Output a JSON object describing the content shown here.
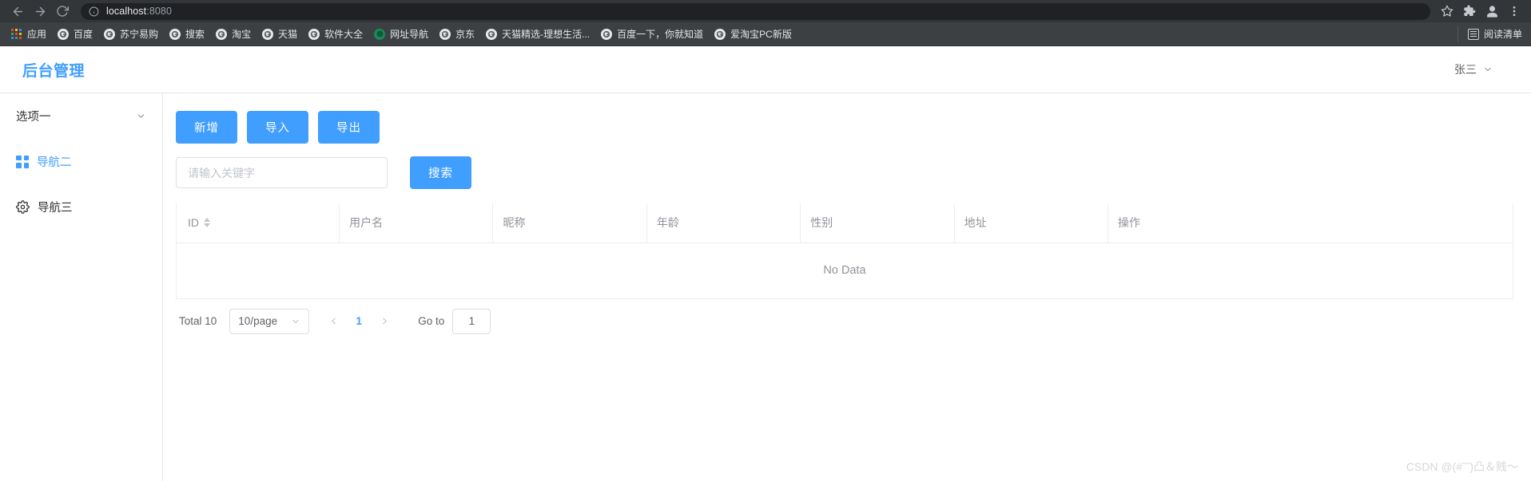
{
  "browser": {
    "back_label": "back-arrow",
    "forward_label": "forward-arrow",
    "reload_label": "reload",
    "url_host": "localhost",
    "url_port": ":8080",
    "star_label": "bookmark-star",
    "extensions_label": "extensions",
    "profile_label": "profile",
    "menu_label": "chrome-menu"
  },
  "bookmarks": {
    "apps_label": "应用",
    "items": [
      {
        "label": "百度",
        "color": "#e8e8e8"
      },
      {
        "label": "苏宁易购",
        "color": "#e8e8e8"
      },
      {
        "label": "搜索",
        "color": "#e8e8e8"
      },
      {
        "label": "淘宝",
        "color": "#e8e8e8"
      },
      {
        "label": "天猫",
        "color": "#e8e8e8"
      },
      {
        "label": "软件大全",
        "color": "#e8e8e8"
      },
      {
        "label": "网址导航",
        "color": "#1b8a5a"
      },
      {
        "label": "京东",
        "color": "#e8e8e8"
      },
      {
        "label": "天猫精选-理想生活...",
        "color": "#e8e8e8"
      },
      {
        "label": "百度一下，你就知道",
        "color": "#e8e8e8"
      },
      {
        "label": "爱淘宝PC新版",
        "color": "#e8e8e8"
      }
    ],
    "reading_list": "阅读清单"
  },
  "header": {
    "title": "后台管理",
    "user_name": "张三"
  },
  "sidebar": {
    "items": [
      {
        "label": "选项一",
        "icon": "chevron-down-icon",
        "active": false
      },
      {
        "label": "导航二",
        "icon": "grid-icon",
        "active": true
      },
      {
        "label": "导航三",
        "icon": "gear-icon",
        "active": false
      }
    ]
  },
  "toolbar": {
    "add_label": "新增",
    "import_label": "导入",
    "export_label": "导出"
  },
  "search": {
    "placeholder": "请输入关键字",
    "value": "",
    "button_label": "搜索"
  },
  "table": {
    "columns": [
      {
        "label": "ID",
        "sortable": true
      },
      {
        "label": "用户名",
        "sortable": false
      },
      {
        "label": "昵称",
        "sortable": false
      },
      {
        "label": "年龄",
        "sortable": false
      },
      {
        "label": "性别",
        "sortable": false
      },
      {
        "label": "地址",
        "sortable": false
      },
      {
        "label": "操作",
        "sortable": false
      }
    ],
    "rows": [],
    "empty_text": "No Data"
  },
  "pagination": {
    "total_label": "Total 10",
    "page_size_label": "10/page",
    "prev_label": "‹",
    "current_page": "1",
    "next_label": "›",
    "goto_label": "Go to",
    "goto_value": "1"
  },
  "watermark": "CSDN @(#ˇˇ)凸＆贱～",
  "colors": {
    "accent": "#409EFF",
    "chrome_toolbar": "#323639",
    "chrome_bookmarks": "#3c4043",
    "omnibox": "#202124",
    "border": "#ebeef5",
    "muted_text": "#909399"
  }
}
